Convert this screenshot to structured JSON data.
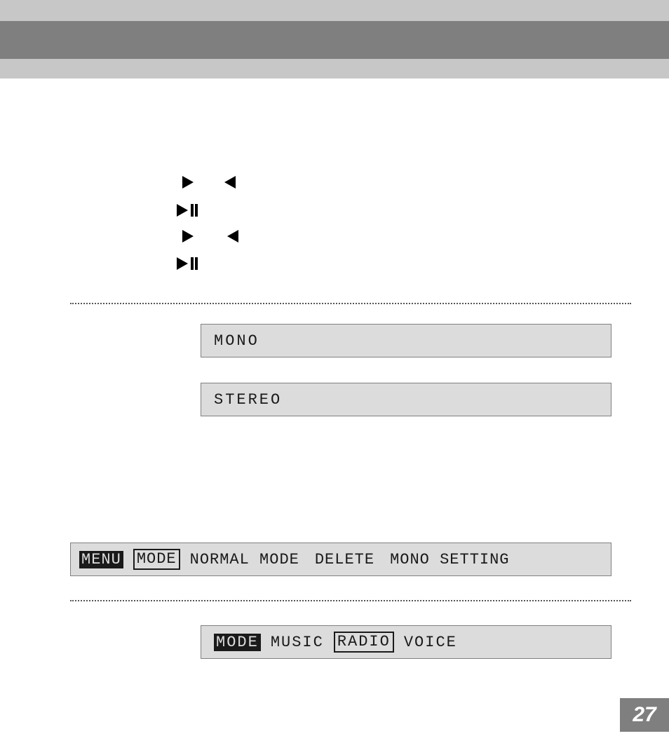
{
  "lcd_mono": "MONO",
  "lcd_stereo": "STEREO",
  "menu_bar": {
    "menu": "MENU",
    "mode": "MODE",
    "normal_mode": "NORMAL MODE",
    "delete": "DELETE",
    "mono_setting": "MONO SETTING"
  },
  "mode_bar": {
    "mode": "MODE",
    "music": "MUSIC",
    "radio": "RADIO",
    "voice": "VOICE"
  },
  "page_number": "27"
}
